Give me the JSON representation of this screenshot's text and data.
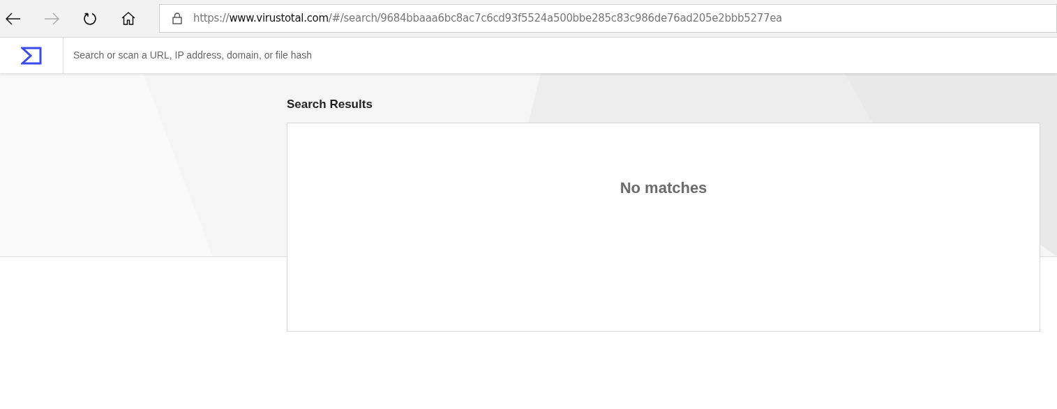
{
  "browser": {
    "back_button": {
      "disabled": false
    },
    "forward_button": {
      "disabled": true
    },
    "address": {
      "scheme": "https://",
      "host": "www.virustotal.com",
      "path": "/#/search/9684bbaaa6bc8ac7c6cd93f5524a500bbe285c83c986de76ad205e2bbb5277ea"
    }
  },
  "search": {
    "placeholder": "Search or scan a URL, IP address, domain, or file hash"
  },
  "results": {
    "title": "Search Results",
    "message": "No matches"
  }
}
